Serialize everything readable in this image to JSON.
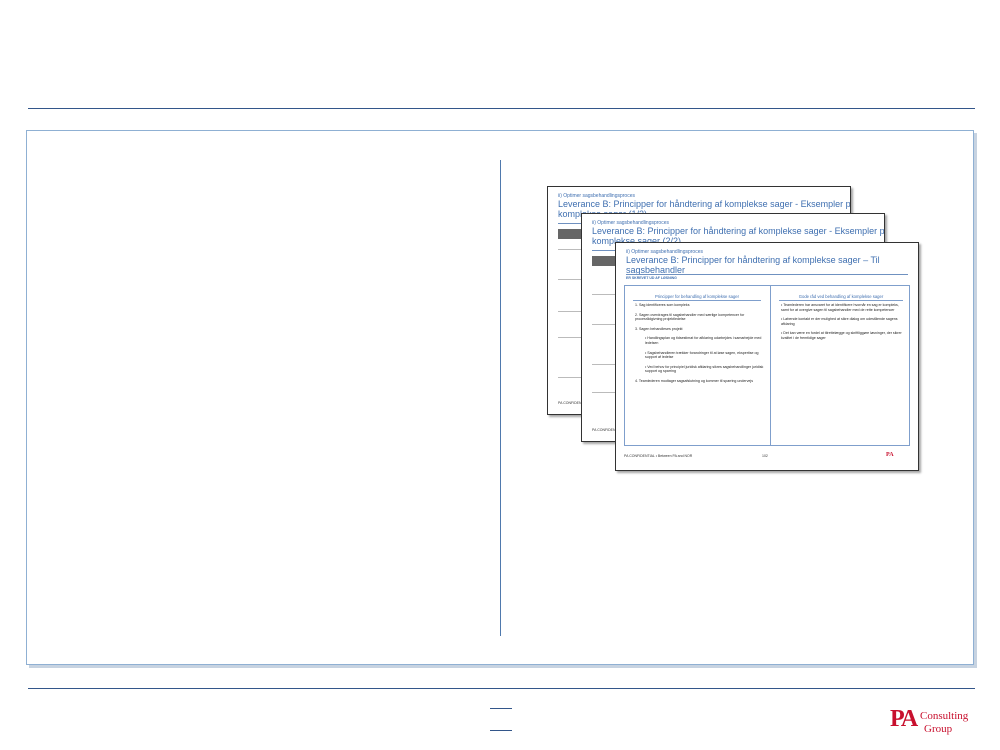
{
  "slides": [
    {
      "subtitle": "ii) Optimer sagsbehandlingsproces",
      "title_line1": "Leverance B: Principper for håndtering af komplekse sager - Eksempler på",
      "title_line2": "komplekse sager (1/2)",
      "footer": "PA CONFIDENTIAL"
    },
    {
      "subtitle": "ii) Optimer sagsbehandlingsproces",
      "title_line1": "Leverance B: Principper for håndtering af komplekse sager - Eksempler på",
      "title_line2": "komplekse sager (2/2)",
      "footer": "PA CONFIDENTIAL"
    },
    {
      "subtitle": "ii) Optimer sagsbehandlingsproces",
      "title_line1": "Leverance B: Principper for håndtering af komplekse sager – Til",
      "title_line2": "sagsbehandler",
      "tag": "ER SKREVET UD AF LØSNING",
      "left_head": "Principper for behandling af komplekse sager",
      "right_head": "Gode råd ved behandling af komplekse sager",
      "left_items": [
        "1.  Sag identificeres som kompleks",
        "2.  Sagen overdrages til sagsbehandler med særlige kompetencer for procesrådgivning projektledelse",
        "3.  Sagen behandleses projekt",
        "•  Handlingsplan og tidsestimat for afklaring udarbejdes i samarbejde med ledelsen",
        "•  Sagsbehandleren trækker forandringer til at løse sagen, ekspertise og support af ledelse",
        "•  Ved behov for principiel juridisk afklaring sikres sagsbehandlinger juridisk support og sparring",
        "4.  Teamlederen modtager sagsafslutning og kommer til sparring undervejs"
      ],
      "right_items": [
        "•  Teamlederen har ansvaret for at identificere hvornår en sag er kompleks, samt for at overgive sagen til sagsbehandler med de rette kompetencer",
        "•  Løbende kontakt er der mulighed at sikre dialog om udestående sagens afklaring",
        "•  Det kan være en fordel at tilrettelægge og skriftliggøre løsninger, der sikrer kvalitet i de fremtidige sager"
      ],
      "footer": "PA CONFIDENTIAL  •  Between PA and NOR",
      "page": "102",
      "logo": "PA"
    }
  ],
  "logo": {
    "mark": "PA",
    "line1": "Consulting",
    "line2": "Group"
  }
}
